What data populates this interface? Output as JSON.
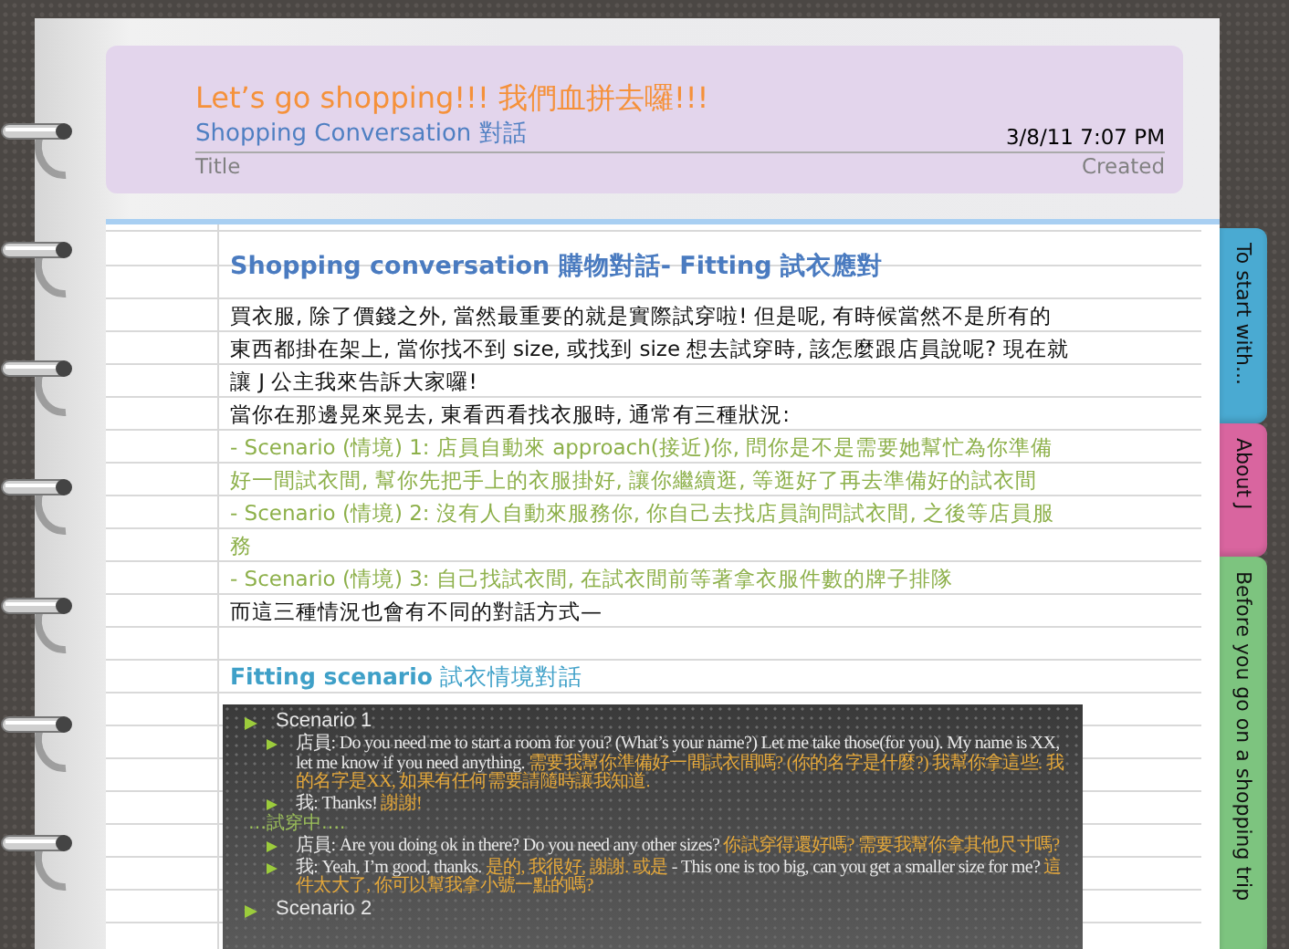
{
  "note": {
    "title": "Let’s go shopping!!! 我們血拼去囉!!!",
    "subtitle": "Shopping Conversation 對話",
    "created": "3/8/11 7:07 PM",
    "title_label": "Title",
    "created_label": "Created"
  },
  "body": [
    {
      "kind": "heading",
      "text": "Shopping conversation 購物對話- Fitting 試衣應對"
    },
    {
      "kind": "paragraph",
      "text": "買衣服,  除了價錢之外, 當然最重要的就是實際試穿啦! 但是呢, 有時候當然不是所有的東西都掛在架上, 當你找不到 size, 或找到 size 想去試穿時, 該怎麼跟店員說呢? 現在就讓 J 公主我來告訴大家囉!"
    },
    {
      "kind": "paragraph",
      "text": "當你在那邊晃來晃去, 東看西看找衣服時, 通常有三種狀況:"
    },
    {
      "kind": "scenario",
      "text": "- Scenario (情境) 1: 店員自動來 approach(接近)你, 問你是不是需要她幫忙為你準備好一間試衣間, 幫你先把手上的衣服掛好, 讓你繼續逛, 等逛好了再去準備好的試衣間"
    },
    {
      "kind": "scenario",
      "text": "- Scenario (情境) 2: 沒有人自動來服務你, 你自己去找店員詢問試衣間, 之後等店員服務"
    },
    {
      "kind": "scenario",
      "text": "- Scenario (情境) 3: 自己找試衣間, 在試衣間前等著拿衣服件數的牌子排隊"
    },
    {
      "kind": "paragraph",
      "text": "而這三種情況也會有不同的對話方式—"
    },
    {
      "kind": "subheading",
      "text": "**Fitting scenario**  試衣情境對話"
    },
    {
      "kind": "slide",
      "items": [
        {
          "kind": "heading",
          "text": "Scenario 1"
        },
        {
          "kind": "bullet",
          "segments": [
            {
              "kind": "en",
              "text": "店員: Do you need me to start a room for you? (What’s your name?) Let me take those(for you). My name is XX, let me know if you need anything."
            },
            {
              "kind": "zh",
              "text": "需要我幫你準備好一間試衣間嗎? (你的名字是什麼?) 我幫你拿這些. 我的名字是XX, 如果有任何需要請隨時讓我知道."
            }
          ]
        },
        {
          "kind": "bullet",
          "segments": [
            {
              "kind": "en",
              "text": "我: Thanks!"
            },
            {
              "kind": "zh",
              "text": "謝謝!"
            }
          ]
        },
        {
          "kind": "note",
          "text": "…試穿中…."
        },
        {
          "kind": "bullet",
          "segments": [
            {
              "kind": "en",
              "text": "店員: Are you doing ok in there? Do you need any other sizes?"
            },
            {
              "kind": "zh",
              "text": "你試穿得還好嗎? 需要我幫你拿其他尺寸嗎?"
            }
          ]
        },
        {
          "kind": "bullet",
          "segments": [
            {
              "kind": "en",
              "text": "我: Yeah, I’m good, thanks."
            },
            {
              "kind": "zh",
              "text": "是的, 我很好, 謝謝. 或是"
            },
            {
              "kind": "en",
              "text": "- This one is too big, can you get a smaller size for me?"
            },
            {
              "kind": "zh",
              "text": "這件太大了, 你可以幫我拿小號一點的嗎?"
            }
          ]
        },
        {
          "kind": "heading",
          "text": "Scenario 2"
        }
      ]
    }
  ],
  "tabs": [
    {
      "label": "To start with...",
      "color": "#4aaad2"
    },
    {
      "label": "About J",
      "color": "#d9659f"
    },
    {
      "label": "Before you go on a shopping trip",
      "color": "#7dc47f"
    }
  ]
}
